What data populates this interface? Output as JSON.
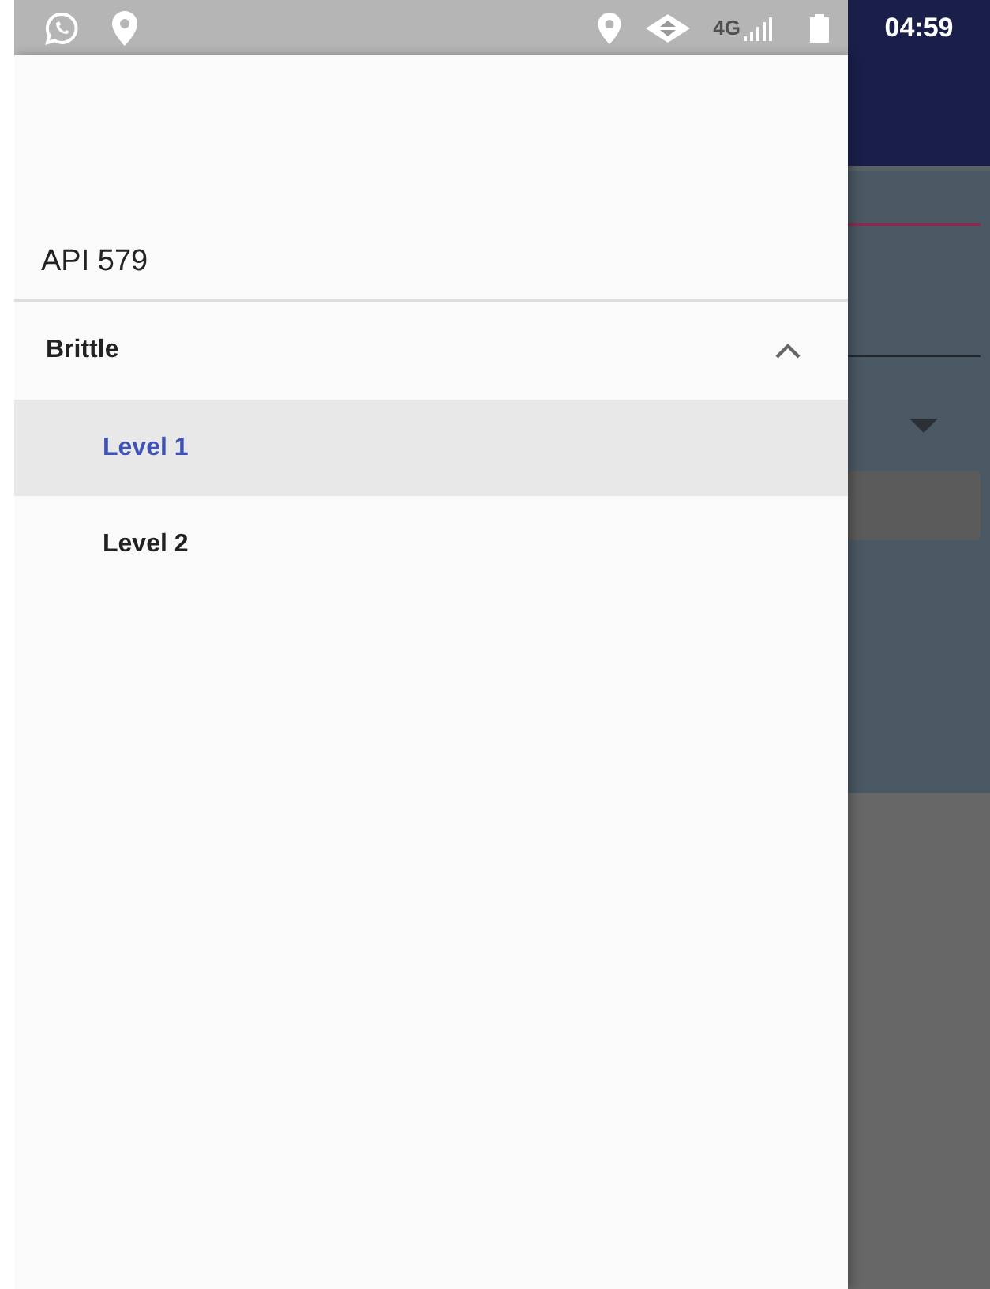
{
  "status_bar": {
    "network": "4G",
    "time": "04:59"
  },
  "drawer": {
    "title": "API 579",
    "items": [
      {
        "label": "Brittle",
        "expanded": true,
        "children": [
          {
            "label": "Level 1",
            "selected": true
          },
          {
            "label": "Level 2",
            "selected": false
          }
        ]
      }
    ]
  }
}
